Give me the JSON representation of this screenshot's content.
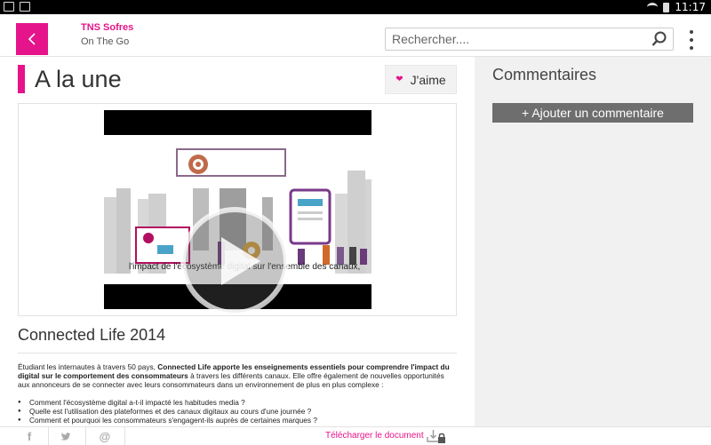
{
  "status_bar": {
    "time": "11:17"
  },
  "header": {
    "app_title": "TNS Sofres",
    "app_subtitle": "On The Go",
    "search_placeholder": "Rechercher...."
  },
  "main": {
    "page_title": "A la une",
    "like_label": "J'aime",
    "video_caption": "l'impact de l'écosystème digital sur l'ensemble des canaux,",
    "article_title": "Connected Life 2014",
    "article_intro": "Étudiant les internautes à travers 50 pays, ",
    "article_bold": "Connected Life apporte les enseignements essentiels pour comprendre l'impact du digital sur le comportement des consommateurs",
    "article_rest": " à travers les différents canaux. Elle offre également de nouvelles opportunités aux annonceurs de se connecter avec leurs consommateurs dans un environnement de plus en plus complexe :",
    "bullets": [
      "Comment l'écosystème digital a-t-il impacté les habitudes media ?",
      "Quelle est l'utilisation des plateformes et des canaux digitaux au cours d'une journée ?",
      "Comment et pourquoi les consommateurs s'engagent-ils auprès de certaines marques ?"
    ]
  },
  "side": {
    "title": "Commentaires",
    "add_comment_label": "+ Ajouter un commentaire"
  },
  "footer": {
    "facebook_glyph": "f",
    "at_glyph": "@",
    "download_label": "Télécharger le document"
  },
  "colors": {
    "accent": "#e5148a",
    "side_panel": "#f1f1f1",
    "button_gray": "#6e6e6e"
  }
}
